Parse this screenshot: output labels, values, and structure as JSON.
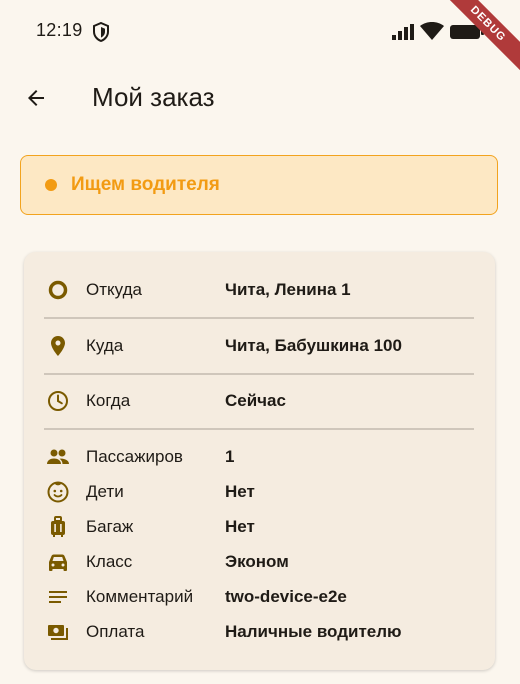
{
  "status_bar": {
    "time": "12:19",
    "debug_label": "DEBUG"
  },
  "app_bar": {
    "back_icon": "arrow-left-icon",
    "title": "Мой заказ"
  },
  "order_status": {
    "text": "Ищем водителя",
    "color": "#f29b13"
  },
  "details": {
    "route": [
      {
        "icon": "circle-origin-icon",
        "label": "Откуда",
        "value": "Чита, Ленина 1"
      },
      {
        "icon": "location-pin-icon",
        "label": "Куда",
        "value": "Чита, Бабушкина 100"
      }
    ],
    "when": {
      "icon": "clock-icon",
      "label": "Когда",
      "value": "Сейчас"
    },
    "params": [
      {
        "icon": "people-icon",
        "label": "Пассажиров",
        "value": "1"
      },
      {
        "icon": "child-face-icon",
        "label": "Дети",
        "value": "Нет"
      },
      {
        "icon": "luggage-icon",
        "label": "Багаж",
        "value": "Нет"
      },
      {
        "icon": "car-icon",
        "label": "Класс",
        "value": "Эконом"
      },
      {
        "icon": "notes-icon",
        "label": "Комментарий",
        "value": "two-device-e2e"
      },
      {
        "icon": "payment-icon",
        "label": "Оплата",
        "value": "Наличные водителю"
      }
    ]
  },
  "colors": {
    "background": "#fbf6ee",
    "card": "#f5ece0",
    "icon": "#7a5a00",
    "accent_border": "#f2a31e",
    "accent_fill": "#fde8c4"
  }
}
